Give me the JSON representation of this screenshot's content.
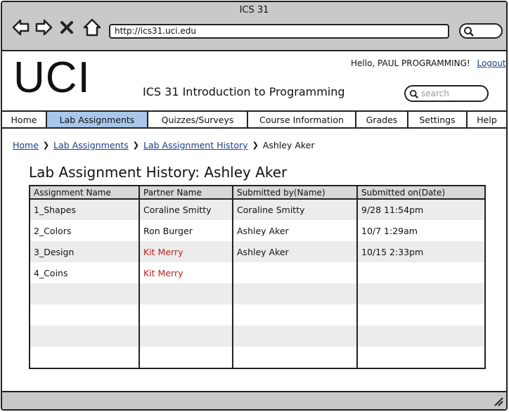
{
  "window": {
    "title": "ICS 31"
  },
  "browser": {
    "url": "http://ics31.uci.edu"
  },
  "site": {
    "logo": "UCI",
    "course_title": "ICS 31 Introduction to Programming",
    "greeting": "Hello, PAUL PROGRAMMING!",
    "logout_label": "Logout",
    "search_placeholder": "search"
  },
  "tabs": [
    {
      "label": "Home"
    },
    {
      "label": "Lab Assignments"
    },
    {
      "label": "Quizzes/Surveys"
    },
    {
      "label": "Course Information"
    },
    {
      "label": "Grades"
    },
    {
      "label": "Settings"
    },
    {
      "label": "Help"
    }
  ],
  "breadcrumb": {
    "items": [
      "Home",
      "Lab Assignments",
      "Lab Assignment History"
    ],
    "current": "Ashley Aker"
  },
  "page": {
    "heading": "Lab Assignment History: Ashley Aker"
  },
  "table": {
    "columns": [
      "Assignment Name",
      "Partner Name",
      "Submitted by(Name)",
      "Submitted on(Date)"
    ],
    "rows": [
      [
        "1_Shapes",
        "Coraline Smitty",
        "Coraline Smitty",
        "9/28 11:54pm"
      ],
      [
        "2_Colors",
        "Ron Burger",
        "Ashley Aker",
        "10/7 1:29am"
      ],
      [
        "3_Design",
        "Kit Merry",
        "Ashley Aker",
        "10/15 2:33pm"
      ],
      [
        "4_Coins",
        "Kit Merry",
        "",
        ""
      ],
      [
        "",
        "",
        "",
        ""
      ],
      [
        "",
        "",
        "",
        ""
      ],
      [
        "",
        "",
        "",
        ""
      ],
      [
        "",
        "",
        "",
        ""
      ]
    ]
  },
  "colors": {
    "active_tab": "#a8c7ea",
    "link": "#1a3e8a",
    "highlight_text": "#c0201f"
  }
}
